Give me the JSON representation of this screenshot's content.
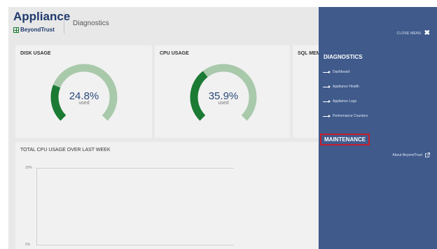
{
  "header": {
    "app_title": "Appliance",
    "brand": "BeyondTrust",
    "page_name": "Diagnostics"
  },
  "cards": {
    "disk": {
      "title": "DISK USAGE",
      "value": "24.8%",
      "used_label": "used",
      "percent": 24.8
    },
    "cpu": {
      "title": "CPU USAGE",
      "value": "35.9%",
      "used_label": "used",
      "percent": 35.9
    },
    "sql": {
      "title": "SQL MEM"
    }
  },
  "chart_data": {
    "type": "line",
    "title": "TOTAL CPU USAGE OVER LAST WEEK",
    "ylim": [
      0,
      20
    ],
    "yticks": [
      "20%",
      "0%"
    ],
    "series": []
  },
  "menu": {
    "close_label": "CLOSE MENU",
    "diagnostics_heading": "DIAGNOSTICS",
    "items": [
      {
        "label": "Dashboard"
      },
      {
        "label": "Appliance Health"
      },
      {
        "label": "Appliance Logs"
      },
      {
        "label": "Performance Counters"
      }
    ],
    "maintenance_heading": "MAINTENANCE",
    "about_label": "About BeyondTrust"
  },
  "colors": {
    "gauge_fill": "#1b7a33",
    "gauge_track": "#a9c9ab",
    "menu_bg": "#3f5a8b",
    "highlight": "#c41f2e"
  }
}
